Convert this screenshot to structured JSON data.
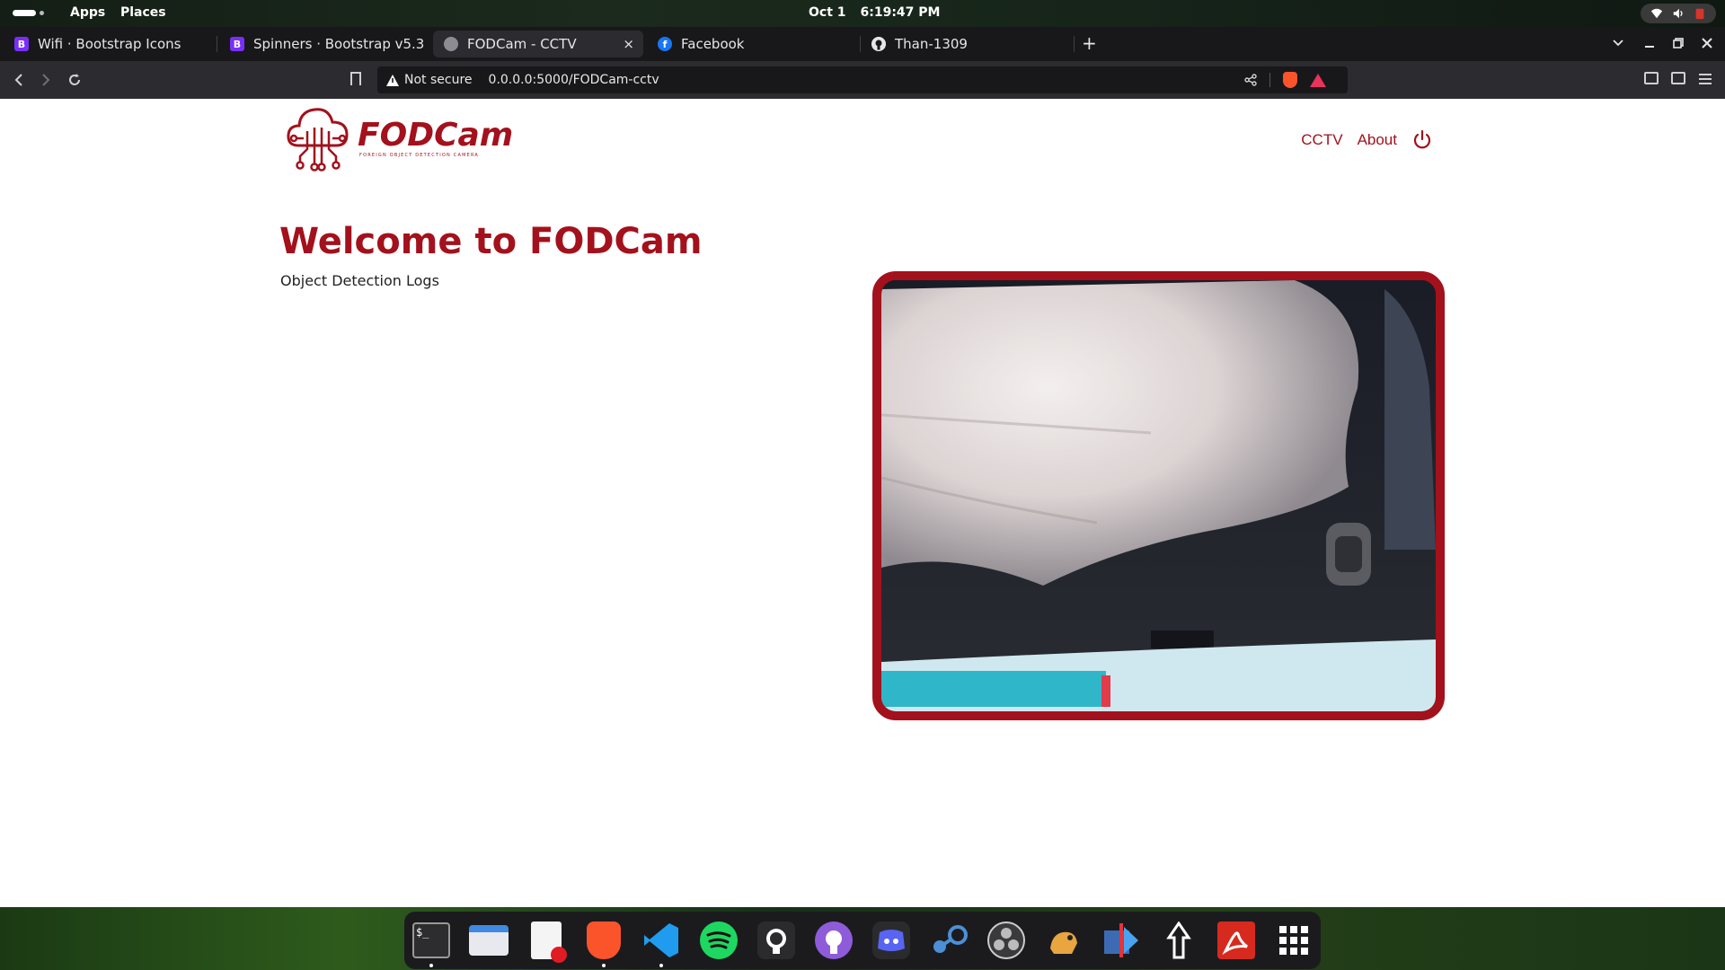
{
  "topbar": {
    "apps_label": "Apps",
    "places_label": "Places",
    "date": "Oct 1",
    "time": "6:19:47 PM"
  },
  "tabs": [
    {
      "title": "Wifi · Bootstrap Icons",
      "favicon": "bootstrap-icon",
      "active": false
    },
    {
      "title": "Spinners · Bootstrap v5.3",
      "favicon": "bootstrap-icon",
      "active": false
    },
    {
      "title": "FODCam - CCTV",
      "favicon": "globe-icon",
      "active": true
    },
    {
      "title": "Facebook",
      "favicon": "facebook-icon",
      "active": false
    },
    {
      "title": "Than-1309",
      "favicon": "github-icon",
      "active": false
    }
  ],
  "tab_glyphs": {
    "bootstrap": "B",
    "facebook": "f",
    "close": "×",
    "new_tab": "+"
  },
  "address_bar": {
    "security_label": "Not secure",
    "url": "0.0.0.0:5000/FODCam-cctv"
  },
  "site": {
    "logo_name": "FODCam",
    "logo_tagline": "FOREIGN OBJECT DETECTION CAMERA",
    "nav": {
      "cctv": "CCTV",
      "about": "About"
    },
    "heading": "Welcome to FODCam",
    "subheading": "Object Detection Logs",
    "brand_color": "#a3111c"
  },
  "dock": {
    "apps": [
      "terminal-icon",
      "files-icon",
      "text-editor-icon",
      "brave-icon",
      "vscode-icon",
      "spotify-icon",
      "github-desktop-icon",
      "github-purple-icon",
      "discord-icon",
      "steam-icon",
      "obs-icon",
      "game-icon",
      "dev-tool-icon",
      "inkscape-icon",
      "acrobat-icon",
      "app-grid-icon"
    ],
    "terminal_glyph": "$_"
  }
}
